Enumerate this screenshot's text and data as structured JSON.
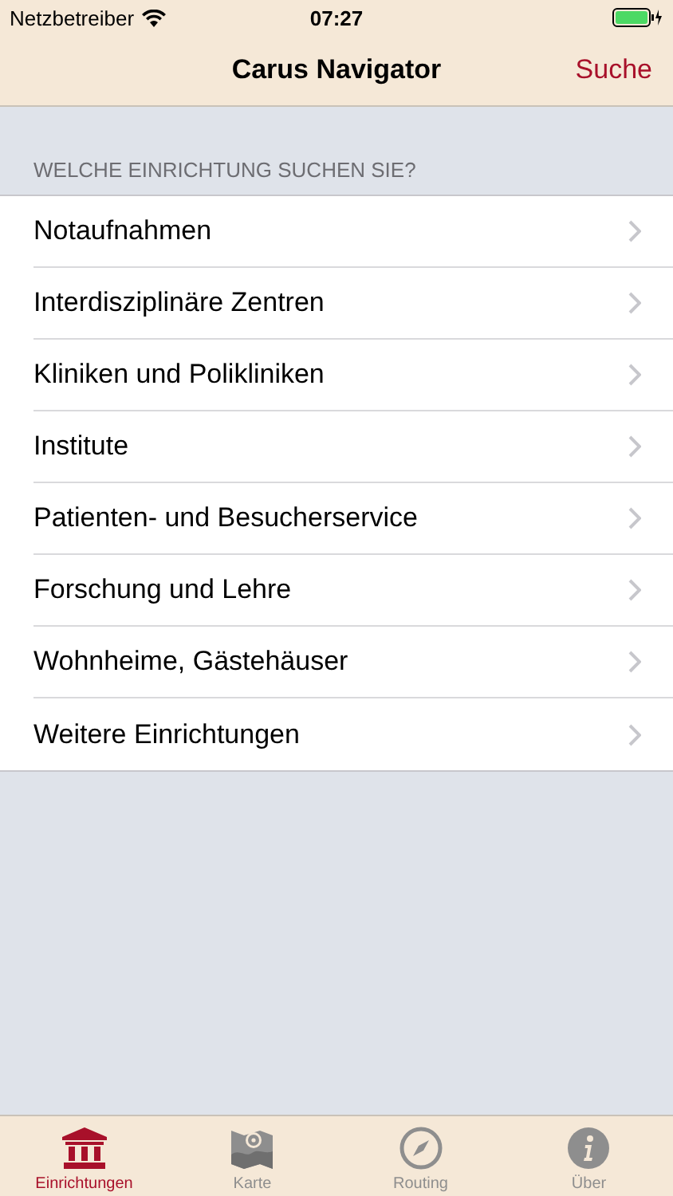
{
  "status_bar": {
    "carrier": "Netzbetreiber",
    "time": "07:27"
  },
  "nav_bar": {
    "title": "Carus Navigator",
    "action": "Suche"
  },
  "section": {
    "header": "WELCHE EINRICHTUNG SUCHEN SIE?",
    "items": [
      {
        "label": "Notaufnahmen"
      },
      {
        "label": "Interdisziplinäre Zentren"
      },
      {
        "label": "Kliniken und Polikliniken"
      },
      {
        "label": "Institute"
      },
      {
        "label": "Patienten- und Besucherservice"
      },
      {
        "label": "Forschung und Lehre"
      },
      {
        "label": "Wohnheime, Gästehäuser"
      },
      {
        "label": "Weitere Einrichtungen"
      }
    ]
  },
  "tab_bar": [
    {
      "label": "Einrichtungen",
      "kind": "building",
      "selected": true
    },
    {
      "label": "Karte",
      "kind": "map",
      "selected": false
    },
    {
      "label": "Routing",
      "kind": "compass",
      "selected": false
    },
    {
      "label": "Über",
      "kind": "info",
      "selected": false
    }
  ]
}
